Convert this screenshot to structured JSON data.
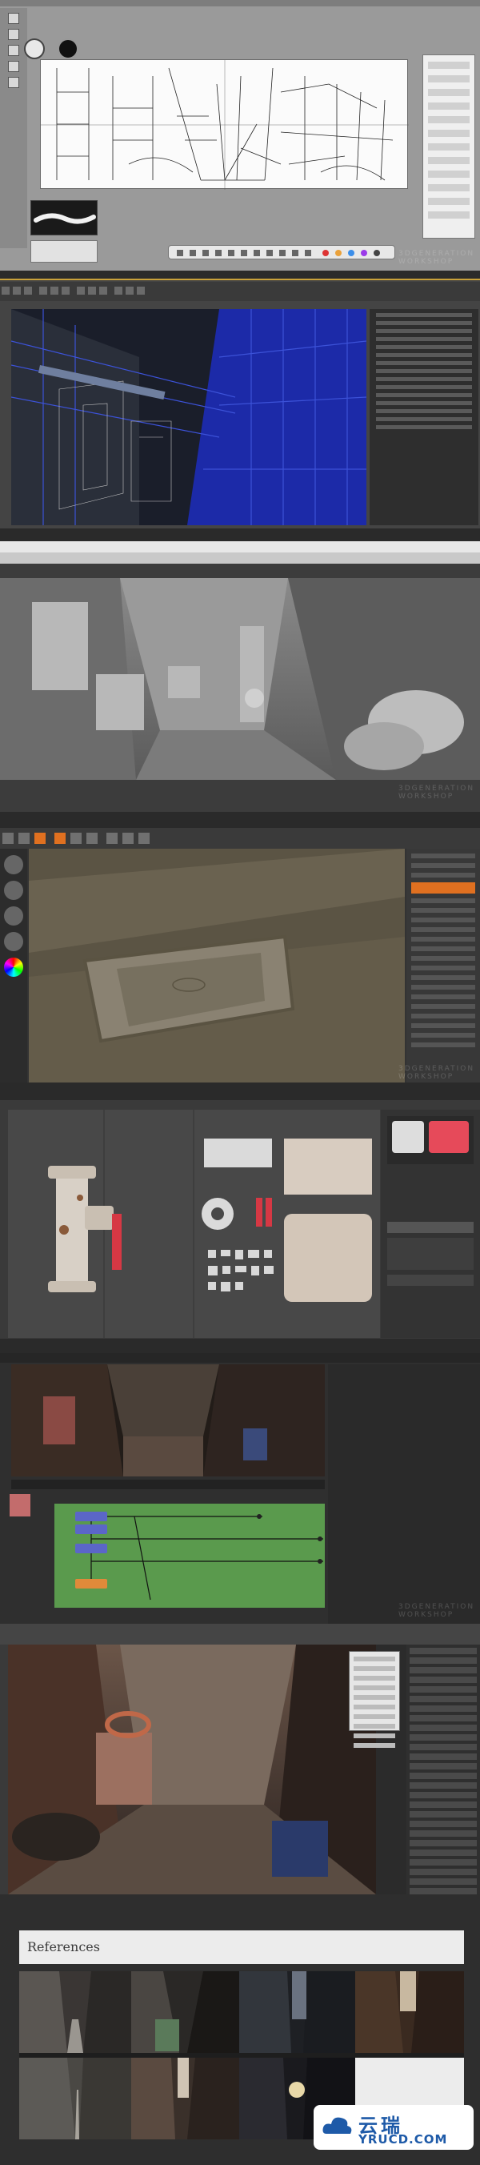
{
  "watermark": {
    "text": "3DGENERATION WORKSHOP"
  },
  "references": {
    "title": "References"
  },
  "brand": {
    "name_cn": "云瑞",
    "name_en": "YRUCD.COM"
  }
}
